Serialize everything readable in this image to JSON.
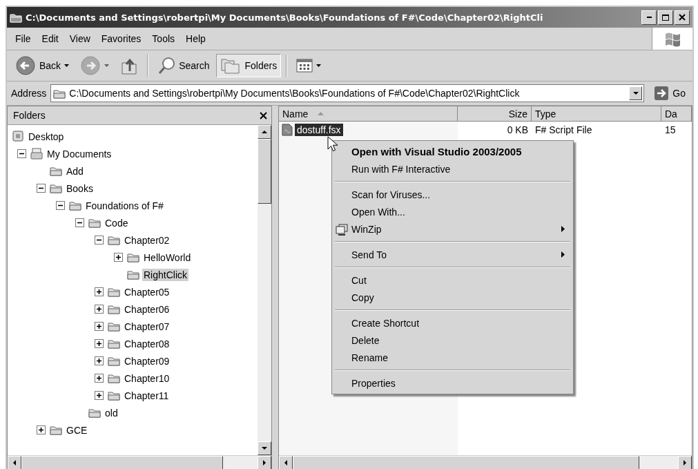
{
  "window": {
    "title": "C:\\Documents and Settings\\robertpi\\My Documents\\Books\\Foundations of F#\\Code\\Chapter02\\RightCli"
  },
  "menu_bar": [
    "File",
    "Edit",
    "View",
    "Favorites",
    "Tools",
    "Help"
  ],
  "toolbar": [
    {
      "kind": "back",
      "label": "Back",
      "disabled": false
    },
    {
      "kind": "forward",
      "disabled": true
    },
    {
      "kind": "up",
      "disabled": false
    },
    {
      "kind": "separator"
    },
    {
      "kind": "search",
      "label": "Search",
      "selected": false
    },
    {
      "kind": "folders",
      "label": "Folders",
      "selected": true
    },
    {
      "kind": "separator"
    },
    {
      "kind": "views"
    }
  ],
  "address": {
    "label": "Address",
    "value": "C:\\Documents and Settings\\robertpi\\My Documents\\Books\\Foundations of F#\\Code\\Chapter02\\RightClick",
    "go_label": "Go"
  },
  "folders_pane": {
    "title": "Folders",
    "tree": [
      {
        "label": "Desktop",
        "kind": "desktop",
        "selected": false,
        "children": [
          {
            "label": "My Documents",
            "kind": "documents",
            "has_toggle": true,
            "expanded": true,
            "selected": false,
            "children": [
              {
                "label": "Add",
                "kind": "folder",
                "has_toggle": false,
                "expanded": false,
                "selected": false
              },
              {
                "label": "Books",
                "kind": "folder",
                "has_toggle": true,
                "expanded": true,
                "selected": false,
                "children": [
                  {
                    "label": "Foundations of F#",
                    "kind": "folder",
                    "has_toggle": true,
                    "expanded": true,
                    "selected": false,
                    "children": [
                      {
                        "label": "Code",
                        "kind": "folder",
                        "has_toggle": true,
                        "expanded": true,
                        "selected": false,
                        "children": [
                          {
                            "label": "Chapter02",
                            "kind": "folder",
                            "has_toggle": true,
                            "expanded": true,
                            "selected": false,
                            "children": [
                              {
                                "label": "HelloWorld",
                                "kind": "folder",
                                "has_toggle": true,
                                "expanded": false,
                                "selected": false
                              },
                              {
                                "label": "RightClick",
                                "kind": "folder",
                                "has_toggle": false,
                                "expanded": false,
                                "selected": true
                              }
                            ]
                          },
                          {
                            "label": "Chapter05",
                            "kind": "folder",
                            "has_toggle": true,
                            "expanded": false,
                            "selected": false
                          },
                          {
                            "label": "Chapter06",
                            "kind": "folder",
                            "has_toggle": true,
                            "expanded": false,
                            "selected": false
                          },
                          {
                            "label": "Chapter07",
                            "kind": "folder",
                            "has_toggle": true,
                            "expanded": false,
                            "selected": false
                          },
                          {
                            "label": "Chapter08",
                            "kind": "folder",
                            "has_toggle": true,
                            "expanded": false,
                            "selected": false
                          },
                          {
                            "label": "Chapter09",
                            "kind": "folder",
                            "has_toggle": true,
                            "expanded": false,
                            "selected": false
                          },
                          {
                            "label": "Chapter10",
                            "kind": "folder",
                            "has_toggle": true,
                            "expanded": false,
                            "selected": false
                          },
                          {
                            "label": "Chapter11",
                            "kind": "folder",
                            "has_toggle": true,
                            "expanded": false,
                            "selected": false
                          }
                        ]
                      },
                      {
                        "label": "old",
                        "kind": "folder",
                        "has_toggle": false,
                        "expanded": false,
                        "selected": false
                      }
                    ]
                  }
                ]
              },
              {
                "label": "GCE",
                "kind": "folder",
                "has_toggle": true,
                "expanded": false,
                "selected": false
              }
            ]
          }
        ]
      }
    ]
  },
  "file_list": {
    "columns": [
      {
        "label": "Name",
        "sorted": true
      },
      {
        "label": "Size",
        "sorted": false
      },
      {
        "label": "Type",
        "sorted": false
      },
      {
        "label": "Da",
        "sorted": false
      }
    ],
    "rows": [
      {
        "cells": [
          "dostuff.fsx",
          "0 KB",
          "F# Script File",
          "15"
        ],
        "selected": true
      }
    ]
  },
  "context_menu": [
    {
      "kind": "default",
      "label": "Open with Visual Studio 2003/2005"
    },
    {
      "kind": "item",
      "label": "Run with F# Interactive"
    },
    {
      "kind": "separator"
    },
    {
      "kind": "item",
      "label": "Scan for Viruses..."
    },
    {
      "kind": "item",
      "label": "Open With..."
    },
    {
      "kind": "submenu",
      "label": "WinZip",
      "has_icon": true
    },
    {
      "kind": "separator"
    },
    {
      "kind": "submenu",
      "label": "Send To",
      "has_icon": false
    },
    {
      "kind": "separator"
    },
    {
      "kind": "item",
      "label": "Cut"
    },
    {
      "kind": "item",
      "label": "Copy"
    },
    {
      "kind": "separator"
    },
    {
      "kind": "item",
      "label": "Create Shortcut"
    },
    {
      "kind": "item",
      "label": "Delete"
    },
    {
      "kind": "item",
      "label": "Rename"
    },
    {
      "kind": "separator"
    },
    {
      "kind": "item",
      "label": "Properties"
    }
  ]
}
